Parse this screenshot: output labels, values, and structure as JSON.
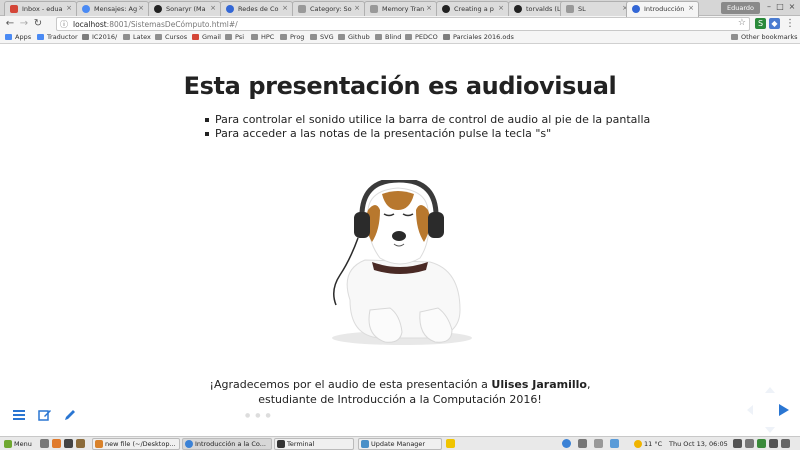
{
  "browser": {
    "tabs": [
      {
        "label": "Inbox - edua",
        "color": "#d44638"
      },
      {
        "label": "Mensajes: Ag",
        "color": "#4a8af4"
      },
      {
        "label": "Sonaryr (Ma",
        "color": "#222222"
      },
      {
        "label": "Redes de Co",
        "color": "#3367d6"
      },
      {
        "label": "Category: So",
        "color": "#777777"
      },
      {
        "label": "Memory Tran",
        "color": "#777777"
      },
      {
        "label": "Creating a p",
        "color": "#222222"
      },
      {
        "label": "torvalds (Lin",
        "color": "#222222"
      },
      {
        "label": "SL",
        "color": "#777777"
      },
      {
        "label": "Introducción",
        "color": "#3367d6",
        "active": true
      }
    ],
    "profile": "Eduardo",
    "url_host": "localhost",
    "url_rest": ":8001/SistemasDeCómputo.html#/",
    "bookmarks": [
      "Apps",
      "Traductor",
      "IC2016/",
      "Latex",
      "Cursos",
      "Gmail",
      "Psi",
      "HPC",
      "Prog",
      "SVG",
      "Github",
      "Blind",
      "PEDCO",
      "Parciales 2016.ods"
    ],
    "other_bookmarks": "Other bookmarks"
  },
  "slide": {
    "title": "Esta presentación es audiovisual",
    "bullets": [
      "Para controlar el sonido utilice la barra de control de audio al pie de la pantalla",
      "Para acceder a las notas de la presentación pulse la tecla \"s\""
    ],
    "thanks_prefix": "¡Agradecemos por el audio de esta presentación a ",
    "thanks_name": "Ulises Jaramillo",
    "thanks_suffix": ",",
    "thanks_line2": "estudiante de Introducción a la Computación 2016!"
  },
  "controls": {
    "menu_icon": "hamburger-menu-icon",
    "edit_icon": "edit-icon",
    "pen_icon": "pen-icon",
    "accent": "#2a76d2"
  },
  "taskbar": {
    "menu_label": "Menu",
    "windows": [
      {
        "label": "new file (~/Desktop...",
        "color": "#d9822b"
      },
      {
        "label": "Introducción a la Co...",
        "color": "#3b82d6",
        "active": true
      },
      {
        "label": "Terminal",
        "color": "#333333"
      },
      {
        "label": "Update Manager",
        "color": "#4a90c8"
      }
    ],
    "weather": "11 °C",
    "clock": "Thu Oct 13, 06:05"
  }
}
